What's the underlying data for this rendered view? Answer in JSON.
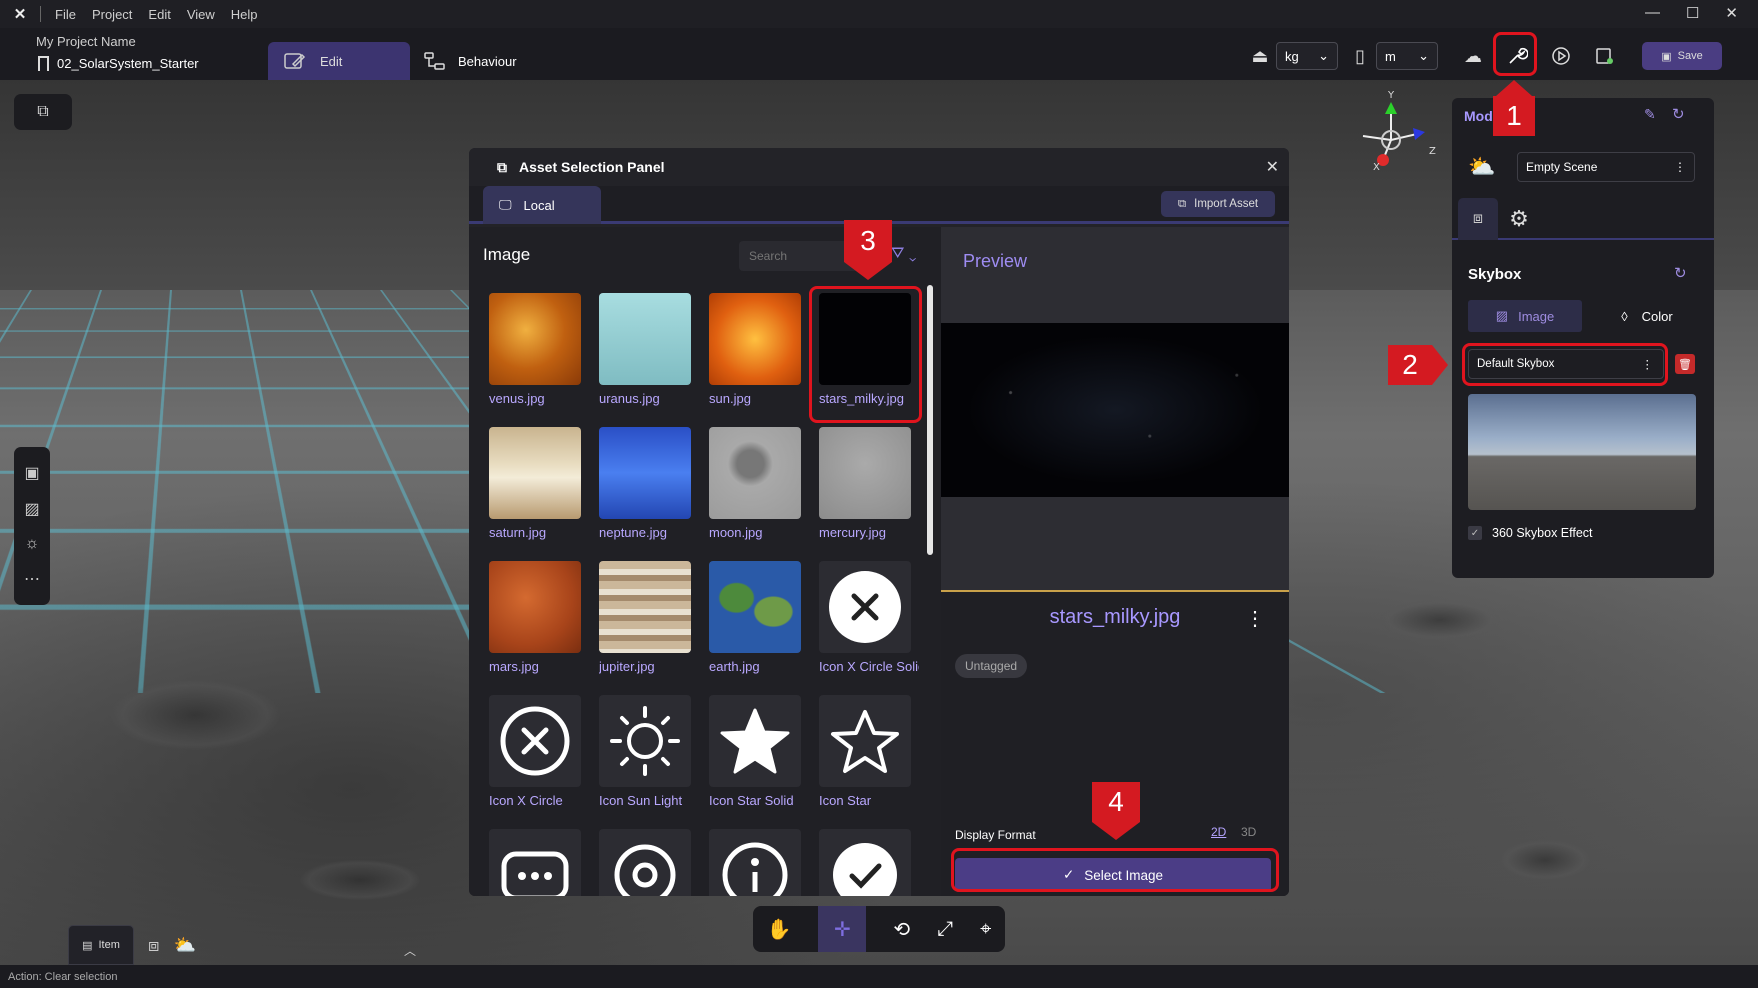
{
  "menubar": {
    "logo": "✕",
    "items": [
      "File",
      "Project",
      "Edit",
      "View",
      "Help"
    ]
  },
  "toolbar": {
    "project_name": "My Project Name",
    "scene_name": "02_SolarSystem_Starter",
    "tab_edit": "Edit",
    "tab_behaviour": "Behaviour",
    "mass_unit": "kg",
    "length_unit": "m",
    "save_label": "Save"
  },
  "asset_panel": {
    "title": "Asset Selection Panel",
    "tab_local": "Local",
    "import_label": "Import Asset",
    "section_title": "Image",
    "search_placeholder": "Search",
    "assets": [
      {
        "label": "venus.jpg",
        "icon": "venus-texture"
      },
      {
        "label": "uranus.jpg",
        "icon": "uranus-texture"
      },
      {
        "label": "sun.jpg",
        "icon": "sun-texture"
      },
      {
        "label": "stars_milky.jpg",
        "icon": "stars-texture"
      },
      {
        "label": "saturn.jpg",
        "icon": "saturn-texture"
      },
      {
        "label": "neptune.jpg",
        "icon": "neptune-texture"
      },
      {
        "label": "moon.jpg",
        "icon": "moon-texture"
      },
      {
        "label": "mercury.jpg",
        "icon": "mercury-texture"
      },
      {
        "label": "mars.jpg",
        "icon": "mars-texture"
      },
      {
        "label": "jupiter.jpg",
        "icon": "jupiter-texture"
      },
      {
        "label": "earth.jpg",
        "icon": "earth-texture"
      },
      {
        "label": "Icon X Circle Solid",
        "icon": "x-circle-solid-icon"
      },
      {
        "label": "Icon X Circle",
        "icon": "x-circle-icon"
      },
      {
        "label": "Icon Sun Light",
        "icon": "sun-light-icon"
      },
      {
        "label": "Icon Star Solid",
        "icon": "star-solid-icon"
      },
      {
        "label": "Icon Star",
        "icon": "star-icon"
      },
      {
        "label": "",
        "icon": "chat-dots-icon"
      },
      {
        "label": "",
        "icon": "target-icon"
      },
      {
        "label": "",
        "icon": "info-icon"
      },
      {
        "label": "",
        "icon": "check-circle-icon"
      }
    ],
    "preview_title": "Preview",
    "selected_file": "stars_milky.jpg",
    "tag": "Untagged",
    "display_format_label": "Display Format",
    "format_2d": "2D",
    "format_3d": "3D",
    "select_label": "Select Image"
  },
  "module_panel": {
    "title": "Mod",
    "scene_value": "Empty Scene",
    "skybox_title": "Skybox",
    "segment_image": "Image",
    "segment_color": "Color",
    "skybox_value": "Default Skybox",
    "effect_label": "360 Skybox Effect"
  },
  "bottom": {
    "item_tab": "Item",
    "status": "Action: Clear selection"
  },
  "gizmo": {
    "y": "Y",
    "z": "Z",
    "x": "X"
  },
  "callouts": [
    "1",
    "2",
    "3",
    "4"
  ],
  "colors": {
    "accent": "#4b3d86",
    "highlight": "#e0141e",
    "label_purple": "#b9a8ff"
  }
}
